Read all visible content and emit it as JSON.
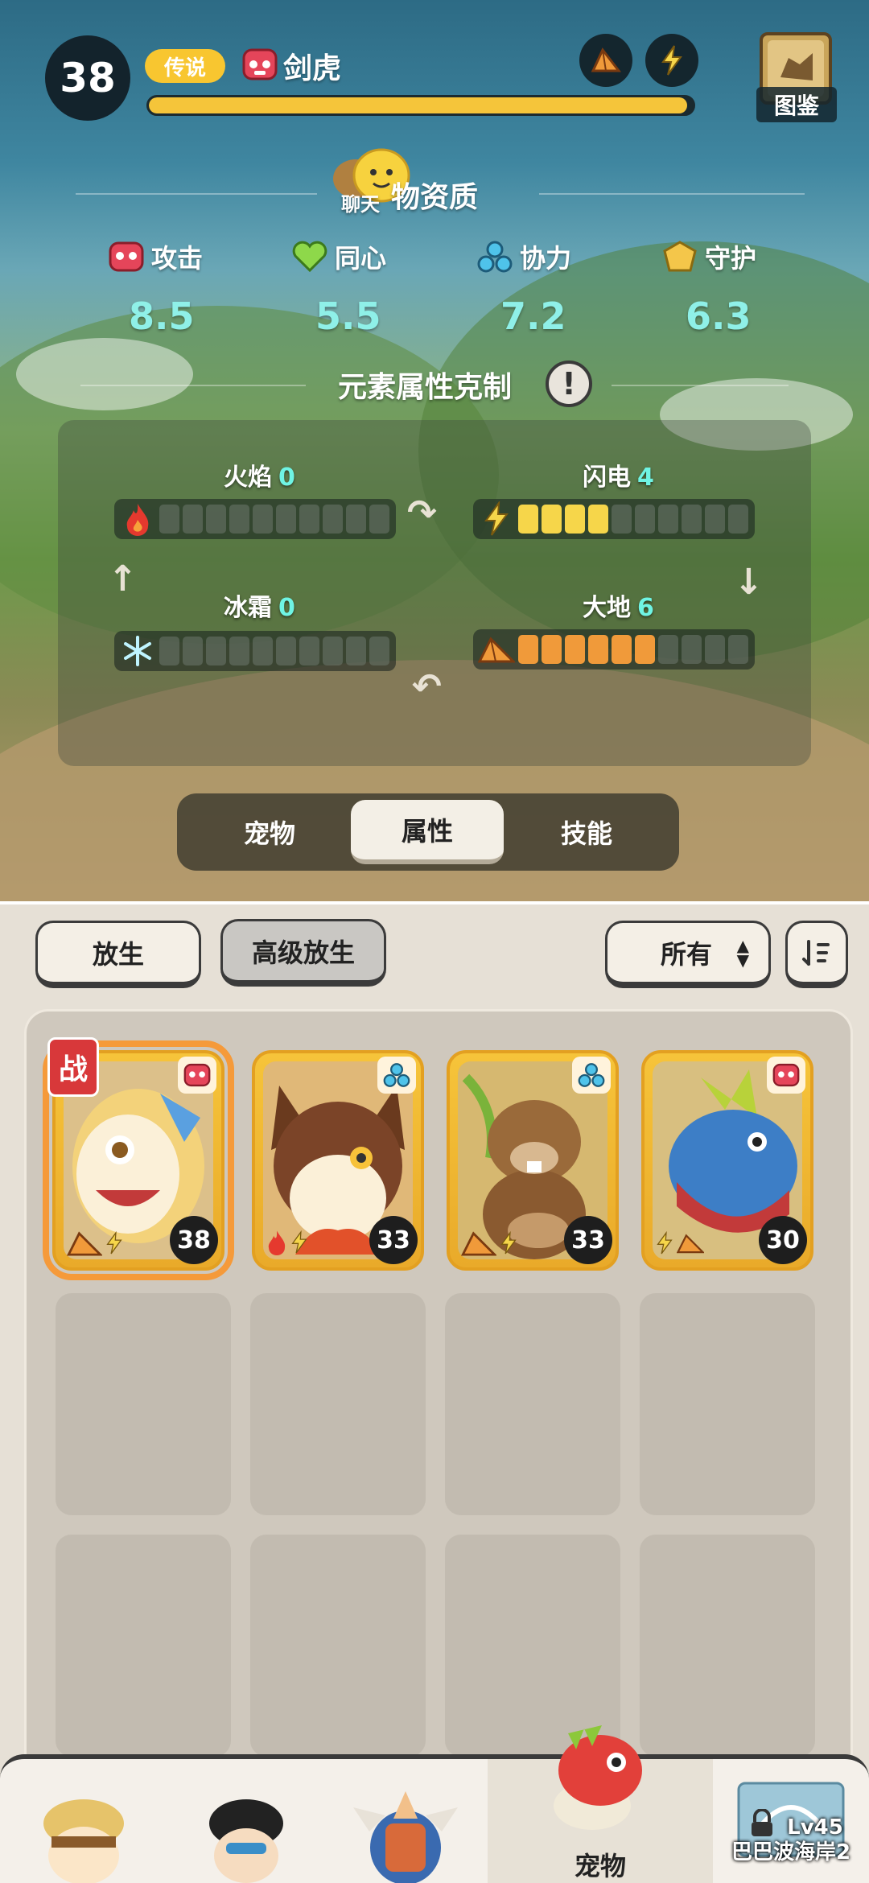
{
  "header": {
    "level": "38",
    "rarity": "传说",
    "pet_name": "剑虎",
    "xp_fraction": 0.99,
    "pokedex_label": "图鉴"
  },
  "chat_label": "聊天",
  "aptitude": {
    "title": "物资质",
    "stats": [
      {
        "label": "攻击",
        "value": "8.5",
        "icon": "attack-icon"
      },
      {
        "label": "同心",
        "value": "5.5",
        "icon": "heart-icon"
      },
      {
        "label": "协力",
        "value": "7.2",
        "icon": "teamwork-icon"
      },
      {
        "label": "守护",
        "value": "6.3",
        "icon": "guard-icon"
      }
    ]
  },
  "elements": {
    "title": "元素属性克制",
    "items": [
      {
        "name": "火焰",
        "value": "0",
        "filled": 0
      },
      {
        "name": "闪电",
        "value": "4",
        "filled": 4
      },
      {
        "name": "冰霜",
        "value": "0",
        "filled": 0
      },
      {
        "name": "大地",
        "value": "6",
        "filled": 6
      }
    ]
  },
  "tabs": [
    {
      "label": "宠物",
      "active": false
    },
    {
      "label": "属性",
      "active": true
    },
    {
      "label": "技能",
      "active": false
    }
  ],
  "toolbar": {
    "release": "放生",
    "advanced_release": "高级放生",
    "filter": "所有"
  },
  "pets": [
    {
      "level": "38",
      "battle_tag": "战",
      "type": "attack",
      "elements": [
        "earth",
        "lightning"
      ],
      "selected": true
    },
    {
      "level": "33",
      "type": "teamwork",
      "elements": [
        "fire",
        "lightning"
      ],
      "selected": false
    },
    {
      "level": "33",
      "type": "teamwork",
      "elements": [
        "earth",
        "lightning"
      ],
      "selected": false
    },
    {
      "level": "30",
      "type": "attack",
      "elements": [
        "lightning",
        "earth"
      ],
      "selected": false
    }
  ],
  "bottom_nav": {
    "active_label": "宠物",
    "locked_level": "Lv45",
    "locked_location": "巴巴波海岸2"
  },
  "colors": {
    "gold": "#f5c53a",
    "cyan_value": "#8ff0e8",
    "lightning": "#f6d64a",
    "earth": "#f09a3a",
    "battle_red": "#d8383a"
  }
}
